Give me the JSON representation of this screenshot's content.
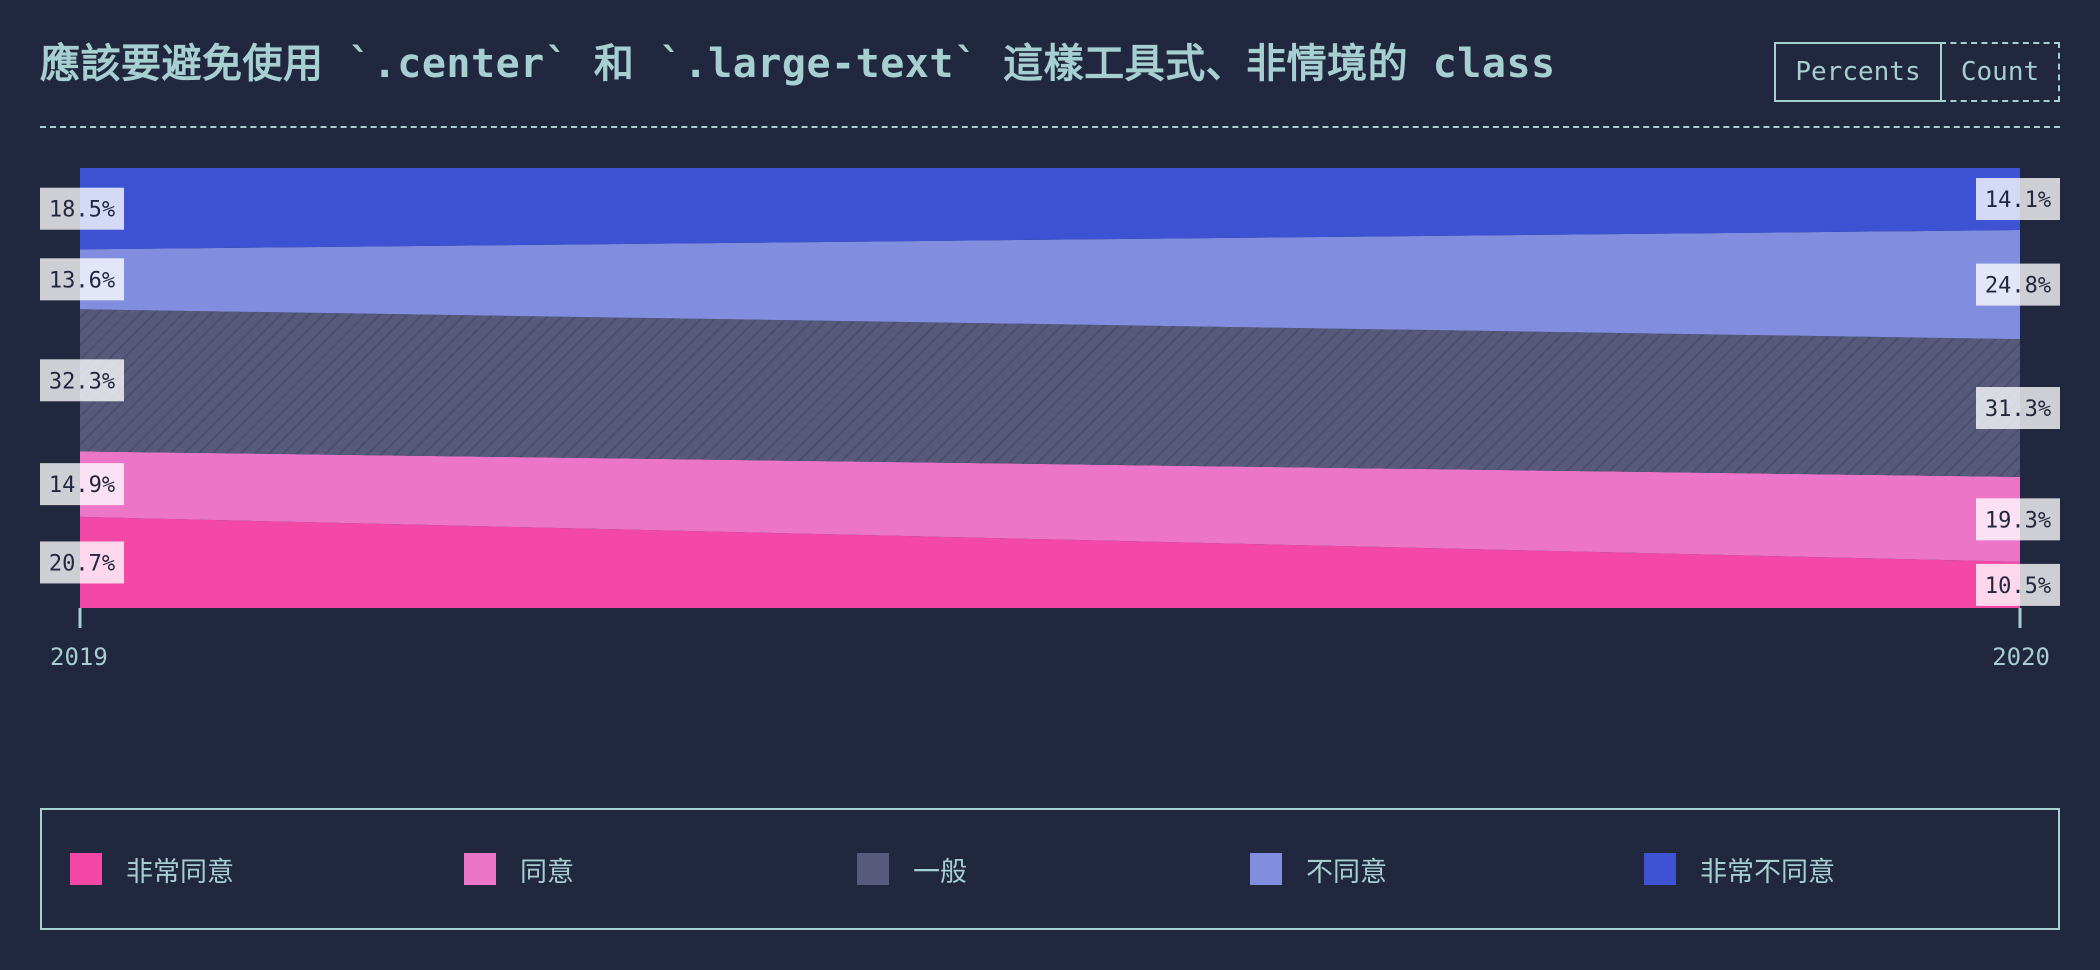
{
  "title": "應該要避免使用 `.center` 和 `.large-text` 這樣工具式、非情境的 class",
  "toggles": {
    "percents": "Percents",
    "count": "Count"
  },
  "colors": {
    "background": "#222740",
    "text": "#a6cfd1",
    "very_agree": "#f448a7",
    "agree": "#ec75c8",
    "neutral": "#575a7b",
    "disagree": "#818ee0",
    "very_disagree": "#3d53d3"
  },
  "chart_data": {
    "type": "area",
    "stacked": true,
    "normalized": true,
    "x": [
      "2019",
      "2020"
    ],
    "series": [
      {
        "name": "非常同意",
        "color": "#f448a7",
        "values": [
          20.7,
          10.5
        ],
        "labels": [
          "20.7%",
          "10.5%"
        ]
      },
      {
        "name": "同意",
        "color": "#ec75c8",
        "values": [
          14.9,
          19.3
        ],
        "labels": [
          "14.9%",
          "19.3%"
        ]
      },
      {
        "name": "一般",
        "color": "#575a7b",
        "values": [
          32.3,
          31.3
        ],
        "labels": [
          "32.3%",
          "31.3%"
        ],
        "pattern": "diagonal-stripes"
      },
      {
        "name": "不同意",
        "color": "#818ee0",
        "values": [
          13.6,
          24.8
        ],
        "labels": [
          "13.6%",
          "24.8%"
        ]
      },
      {
        "name": "非常不同意",
        "color": "#3d53d3",
        "values": [
          18.5,
          14.1
        ],
        "labels": [
          "18.5%",
          "14.1%"
        ]
      }
    ],
    "ylim": [
      0,
      100
    ],
    "legend": "bottom"
  }
}
